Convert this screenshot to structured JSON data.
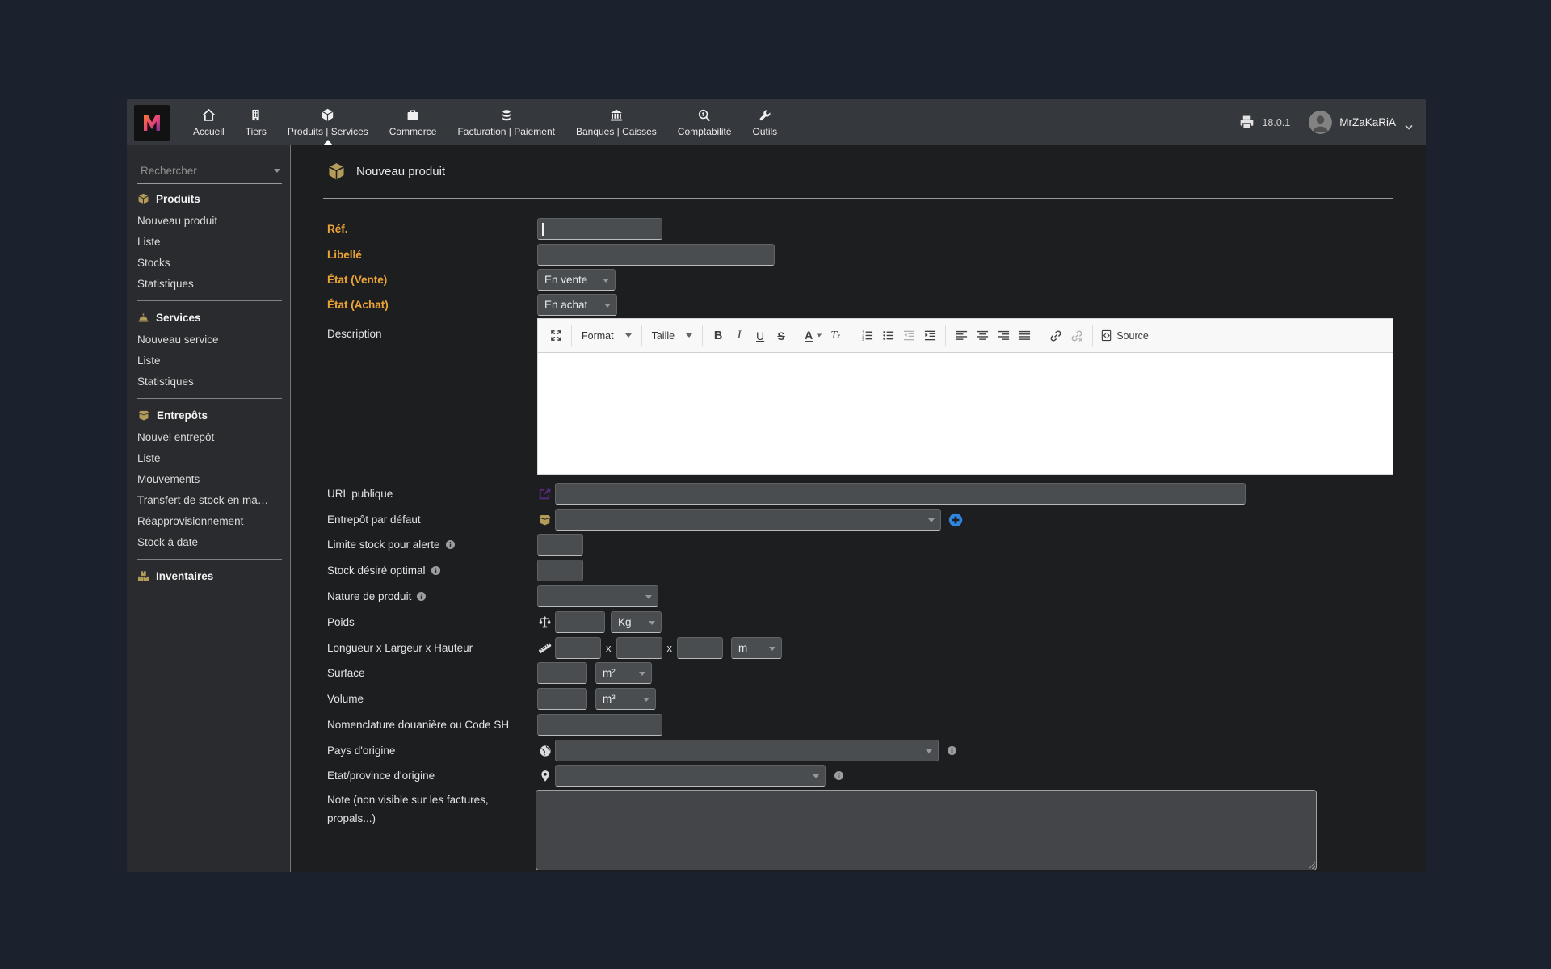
{
  "chrome": {
    "version": "18.0.1",
    "user": "MrZaKaRiA"
  },
  "nav": {
    "items": [
      "Accueil",
      "Tiers",
      "Produits | Services",
      "Commerce",
      "Facturation | Paiement",
      "Banques | Caisses",
      "Comptabilité",
      "Outils"
    ],
    "active": "Produits | Services"
  },
  "sidebar": {
    "search_placeholder": "Rechercher",
    "produits": {
      "title": "Produits",
      "items": [
        "Nouveau produit",
        "Liste",
        "Stocks",
        "Statistiques"
      ]
    },
    "services": {
      "title": "Services",
      "items": [
        "Nouveau service",
        "Liste",
        "Statistiques"
      ]
    },
    "entrepots": {
      "title": "Entrepôts",
      "items": [
        "Nouvel entrepôt",
        "Liste",
        "Mouvements",
        "Transfert de stock en ma…",
        "Réapprovisionnement",
        "Stock à date"
      ]
    },
    "inventaires": {
      "title": "Inventaires"
    }
  },
  "page": {
    "title": "Nouveau produit"
  },
  "form": {
    "ref_label": "Réf.",
    "libelle_label": "Libellé",
    "etat_vente_label": "État (Vente)",
    "etat_vente_value": "En vente",
    "etat_achat_label": "État (Achat)",
    "etat_achat_value": "En achat",
    "description_label": "Description",
    "url_label": "URL publique",
    "entrepot_label": "Entrepôt par défaut",
    "entrepot_value": "",
    "limite_label": "Limite stock pour alerte",
    "stock_optimal_label": "Stock désiré optimal",
    "nature_label": "Nature de produit",
    "nature_value": "",
    "poids_label": "Poids",
    "poids_unit": "Kg",
    "dims_label": "Longueur x Largeur x Hauteur",
    "dims_sep": "x",
    "dims_unit": "m",
    "surface_label": "Surface",
    "surface_unit": "m²",
    "volume_label": "Volume",
    "volume_unit": "m³",
    "nomenclature_label": "Nomenclature douanière ou Code SH",
    "pays_label": "Pays d'origine",
    "pays_value": "",
    "province_label": "Etat/province d'origine",
    "province_value": "",
    "note_label": "Note (non visible sur les factures, propals...)"
  },
  "editor": {
    "format": "Format",
    "taille": "Taille",
    "bold": "B",
    "italic": "I",
    "underline": "U",
    "strike": "S",
    "color": "A",
    "removeformat_t": "T",
    "removeformat_x": "x",
    "source": "Source"
  },
  "colors": {
    "outer_bg": "#1c212e",
    "topbar_bg": "#35383c",
    "sidebar_bg": "#2a2b2e",
    "main_bg": "#1d1e20",
    "accent_gold": "#b39b59",
    "required_label": "#eda437",
    "plus_blue": "#2f86e0",
    "url_icon_purple": "#5a2a80"
  }
}
